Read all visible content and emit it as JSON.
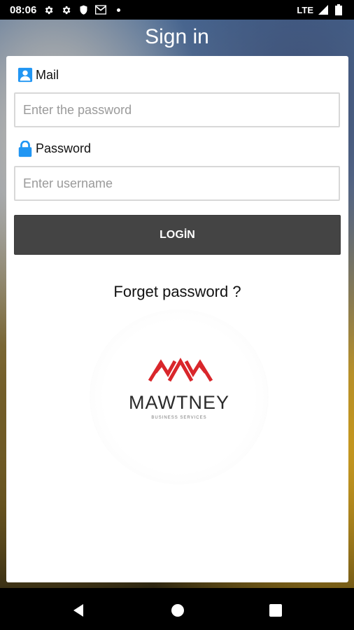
{
  "status_bar": {
    "time": "08:06",
    "network": "LTE",
    "icons": [
      "settings-icon",
      "settings-icon",
      "shield-icon",
      "gmail-icon",
      "dot-icon",
      "signal-icon",
      "battery-icon"
    ]
  },
  "header": {
    "title": "Sign in"
  },
  "form": {
    "mail_label": "Mail",
    "mail_icon": "contact-card-icon",
    "mail_placeholder": "Enter the password",
    "password_label": "Password",
    "password_icon": "lock-icon",
    "password_placeholder": "Enter username",
    "login_label": "LOGİN",
    "forget_label": "Forget password ?"
  },
  "logo": {
    "name": "MAWTNEY",
    "tagline": "BUSINESS SERVICES",
    "brand_color": "#d9262b"
  },
  "nav_bar": {
    "buttons": [
      "back-icon",
      "home-icon",
      "recents-icon"
    ]
  },
  "colors": {
    "accent_blue": "#2196f3",
    "button_dark": "#444444",
    "logo_red": "#d9262b"
  }
}
